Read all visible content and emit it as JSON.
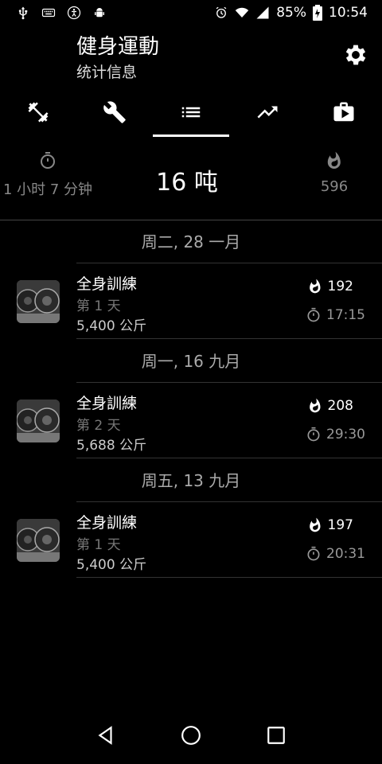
{
  "status_bar": {
    "icons_left": [
      "usb-icon",
      "keyboard-icon",
      "accessibility-icon",
      "android-debug-icon"
    ],
    "icons_right": [
      "alarm-icon",
      "wifi-icon",
      "signal-icon"
    ],
    "battery": "85%",
    "time": "10:54"
  },
  "header": {
    "title": "健身運動",
    "subtitle": "统计信息",
    "settings_icon": "gear-icon"
  },
  "tabs": [
    {
      "icon": "dumbbell-icon",
      "active": false
    },
    {
      "icon": "wrench-icon",
      "active": false
    },
    {
      "icon": "list-icon",
      "active": true
    },
    {
      "icon": "trending-up-icon",
      "active": false
    },
    {
      "icon": "briefcase-play-icon",
      "active": false
    }
  ],
  "summary": {
    "duration": "1 小时 7 分钟",
    "weight": "16 吨",
    "calories": "596"
  },
  "workouts": [
    {
      "date": "周二, 28 一月",
      "name": "全身訓練",
      "day_prefix": "第",
      "day_num": "1",
      "day_suffix": "天",
      "weight": "5,400 公斤",
      "calories": "192",
      "duration": "17:15"
    },
    {
      "date": "周一, 16 九月",
      "name": "全身訓練",
      "day_prefix": "第",
      "day_num": "2",
      "day_suffix": "天",
      "weight": "5,688 公斤",
      "calories": "208",
      "duration": "29:30"
    },
    {
      "date": "周五, 13 九月",
      "name": "全身訓練",
      "day_prefix": "第",
      "day_num": "1",
      "day_suffix": "天",
      "weight": "5,400 公斤",
      "calories": "197",
      "duration": "20:31"
    }
  ],
  "nav": [
    "back-icon",
    "home-icon",
    "recents-icon"
  ]
}
